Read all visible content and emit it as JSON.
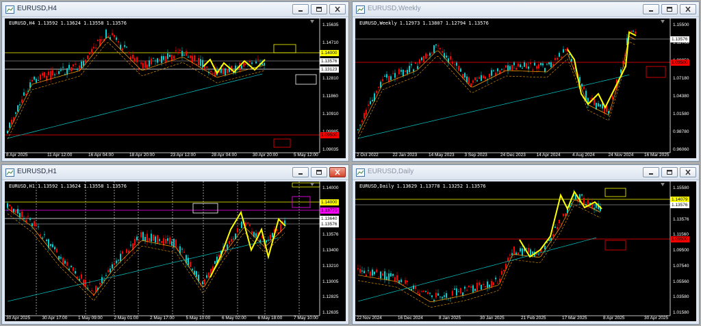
{
  "windows": [
    {
      "id": "h4",
      "title": "EURUSD,H4",
      "info": [
        "EURUSD,H4",
        "1.13592",
        "1.13624",
        "1.13558",
        "1.13576"
      ],
      "y_labels": [
        "1.15635",
        "1.14710",
        "1.13785",
        "1.12810",
        "1.11860",
        "1.10910",
        "1.09985",
        "1.09035"
      ],
      "x_labels": [
        "8 Apr 2025",
        "11 Apr 12:00",
        "16 Apr 04:00",
        "18 Apr 20:00",
        "23 Apr 12:00",
        "28 Apr 04:00",
        "30 Apr 20:00",
        "5 May 12:00"
      ],
      "price_tags": [
        {
          "label": "1.14000",
          "bg": "#ffff00",
          "fg": "#000000"
        },
        {
          "label": "1.13576",
          "bg": "#ffffff",
          "fg": "#000000"
        },
        {
          "label": "1.13123",
          "bg": "#ffffff",
          "fg": "#000000"
        },
        {
          "label": "1.09500",
          "bg": "#ff0000",
          "fg": "#000000"
        }
      ]
    },
    {
      "id": "weekly",
      "title": "EURUSD,Weekly",
      "info": [
        "EURUSD,Weekly",
        "1.12973",
        "1.13807",
        "1.12794",
        "1.13576"
      ],
      "y_labels": [
        "1.15500",
        "1.12700",
        "1.09950",
        "1.07180",
        "1.04380",
        "1.01580",
        "0.98780",
        "0.96060"
      ],
      "x_labels": [
        "2 Oct 2022",
        "22 Jan 2023",
        "14 May 2023",
        "3 Sep 2023",
        "24 Dec 2023",
        "14 Apr 2024",
        "4 Aug 2024",
        "24 Nov 2024",
        "16 Mar 2025"
      ],
      "price_tags": [
        {
          "label": "1.13576",
          "bg": "#ffffff",
          "fg": "#000000"
        },
        {
          "label": "1.09500",
          "bg": "#ff0000",
          "fg": "#000000"
        }
      ]
    },
    {
      "id": "h1",
      "title": "EURUSD,H1",
      "info": [
        "EURUSD,H1",
        "1.13592",
        "1.13624",
        "1.13558",
        "1.13576"
      ],
      "y_labels": [
        "1.14000",
        "1.13785",
        "1.13640",
        "1.13576",
        "1.13400",
        "1.13210",
        "1.13005",
        "1.12825",
        "1.12635"
      ],
      "x_labels": [
        "30 Apr 2025",
        "30 Apr 17:00",
        "1 May 09:00",
        "2 May 01:00",
        "2 May 17:00",
        "5 May 10:00",
        "6 May 02:00",
        "6 May 18:00",
        "7 May 10:00"
      ],
      "price_tags": [
        {
          "label": "1.14000",
          "bg": "#ffff00",
          "fg": "#000000"
        },
        {
          "label": "1.13770",
          "bg": "#ff00ff",
          "fg": "#000000"
        },
        {
          "label": "1.13640",
          "bg": "#ffffff",
          "fg": "#000000"
        },
        {
          "label": "1.13576",
          "bg": "#ffffff",
          "fg": "#000000"
        }
      ]
    },
    {
      "id": "daily",
      "title": "EURUSD,Daily",
      "info": [
        "EURUSD,Daily",
        "1.13629",
        "1.13778",
        "1.13252",
        "1.13576"
      ],
      "y_labels": [
        "1.15580",
        "1.14079",
        "1.13576",
        "1.11560",
        "1.09500",
        "1.07540",
        "1.05560",
        "1.03580",
        "1.01580"
      ],
      "x_labels": [
        "22 Nov 2024",
        "16 Dec 2024",
        "8 Jan 2025",
        "30 Jan 2025",
        "21 Feb 2025",
        "17 Mar 2025",
        "8 Apr 2025",
        "30 Apr 2025"
      ],
      "price_tags": [
        {
          "label": "1.14079",
          "bg": "#ffff00",
          "fg": "#000000"
        },
        {
          "label": "1.13576",
          "bg": "#ffffff",
          "fg": "#000000"
        },
        {
          "label": "1.09500",
          "bg": "#ff0000",
          "fg": "#000000"
        }
      ]
    }
  ],
  "colors": {
    "bull": "#ff0000",
    "bear": "#00d0d0",
    "zigzag": "#ffff00",
    "ma_fast": "#ffa500",
    "ma_slow": "#00cccc",
    "support": "#ff0000",
    "resistance": "#ffff00"
  }
}
